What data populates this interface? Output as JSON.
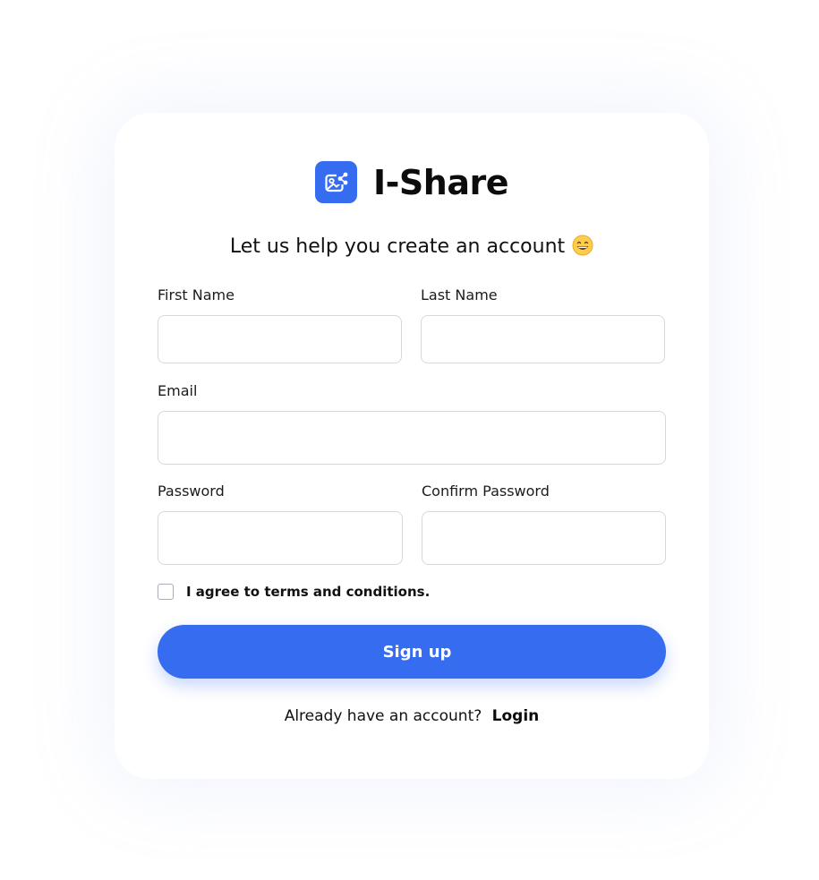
{
  "app": {
    "name": "I-Share",
    "logo_icon": "image-share-icon",
    "accent_color": "#356cf0"
  },
  "subtitle": {
    "text": "Let us help you create an account",
    "emoji_icon": "grinning-face-emoji"
  },
  "form": {
    "first_name": {
      "label": "First Name",
      "value": "",
      "placeholder": ""
    },
    "last_name": {
      "label": "Last Name",
      "value": "",
      "placeholder": ""
    },
    "email": {
      "label": "Email",
      "value": "",
      "placeholder": ""
    },
    "password": {
      "label": "Password",
      "value": "",
      "placeholder": ""
    },
    "confirm_password": {
      "label": "Confirm Password",
      "value": "",
      "placeholder": ""
    },
    "terms": {
      "label": "I agree to terms and conditions.",
      "checked": false
    },
    "submit_label": "Sign up"
  },
  "footer": {
    "prompt": "Already have an account?",
    "login_label": "Login"
  }
}
